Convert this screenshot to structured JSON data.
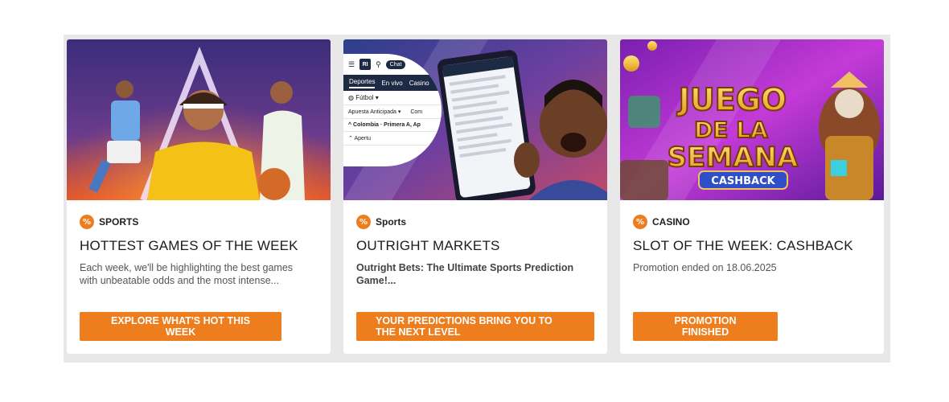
{
  "colors": {
    "accent": "#ee7d1d",
    "panel_bg": "#e8e8e8",
    "card_bg": "#ffffff",
    "title_text": "#1c1c1c",
    "desc_text": "#555555"
  },
  "badge_icon": "percent-badge-icon",
  "cards": [
    {
      "category": "SPORTS",
      "title": "HOTTEST GAMES OF THE WEEK",
      "description": "Each week, we'll be highlighting the best games with unbeatable odds and the most intense...",
      "cta": "EXPLORE WHAT'S HOT THIS WEEK",
      "banner": "sports-players-banner"
    },
    {
      "category": "Sports",
      "title": "OUTRIGHT MARKETS",
      "description": "Outright Bets: The Ultimate Sports Prediction Game!...",
      "cta": "YOUR PREDICTIONS BRING YOU TO THE NEXT LEVEL",
      "banner": "outright-phone-banner",
      "phone_ui": {
        "logo": "RI",
        "chat": "Chat",
        "tabs": [
          "Deportes",
          "En vivo",
          "Casino"
        ],
        "sport": "Fútbol",
        "filter": "Apuesta Anticipada",
        "filter2": "Com",
        "league": "Colombia · Primera A, Ap",
        "item": "Apertu"
      }
    },
    {
      "category": "CASINO",
      "title": "SLOT OF THE WEEK: CASHBACK",
      "description": "Promotion ended on 18.06.2025",
      "cta": "PROMOTION FINISHED",
      "banner": "juego-de-la-semana-banner",
      "banner_text": {
        "line1": "JUEGO",
        "line2": "DE LA",
        "line3": "SEMANA",
        "tag": "CASHBACK"
      }
    }
  ]
}
